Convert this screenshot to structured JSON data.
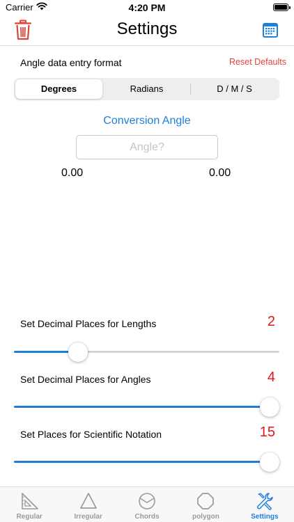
{
  "status_bar": {
    "carrier": "Carrier",
    "time": "4:20 PM"
  },
  "nav": {
    "title": "Settings",
    "left_icon": "trash-icon",
    "right_icon": "calendar-icon"
  },
  "format": {
    "label": "Angle data entry format",
    "reset_label": "Reset Defaults",
    "segments": [
      "Degrees",
      "Radians",
      "D / M / S"
    ],
    "selected": "Degrees"
  },
  "conversion": {
    "title": "Conversion Angle",
    "input_placeholder": "Angle?",
    "input_value": "",
    "result_left": "0.00",
    "result_right": "0.00"
  },
  "sliders": [
    {
      "label": "Set Decimal Places for Lengths",
      "value": "2",
      "fraction": 0.22
    },
    {
      "label": "Set Decimal Places for Angles",
      "value": "4",
      "fraction": 1.0
    },
    {
      "label": "Set Places for Scientific Notation",
      "value": "15",
      "fraction": 1.0
    }
  ],
  "tabs": [
    {
      "label": "Regular",
      "icon": "right-triangle-ruler-icon"
    },
    {
      "label": "Irregular",
      "icon": "triangle-icon"
    },
    {
      "label": "Chords",
      "icon": "circle-chord-icon"
    },
    {
      "label": "polygon",
      "icon": "octagon-icon"
    },
    {
      "label": "Settings",
      "icon": "wrench-screwdriver-icon"
    }
  ],
  "active_tab": "Settings",
  "colors": {
    "accent": "#1e7fd8",
    "destructive": "#e0443a",
    "value_red": "#e3141c"
  }
}
